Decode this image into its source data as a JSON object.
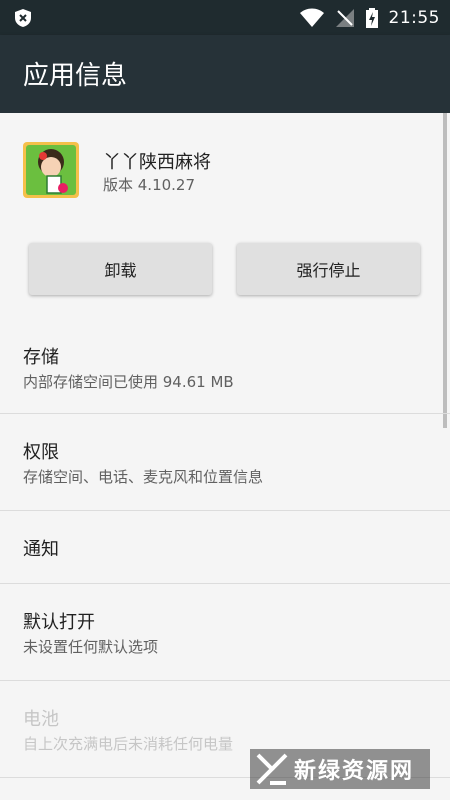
{
  "status_bar": {
    "time": "21:55",
    "icons": [
      "shield-x-icon",
      "wifi-icon",
      "no-signal-icon",
      "battery-charging-icon"
    ]
  },
  "app_bar": {
    "title": "应用信息"
  },
  "app": {
    "name": "丫丫陕西麻将",
    "version": "版本 4.10.27",
    "icon": "mahjong-app-icon"
  },
  "buttons": {
    "uninstall": "卸载",
    "force_stop": "强行停止"
  },
  "sections": {
    "storage": {
      "title": "存储",
      "subtitle": "内部存储空间已使用 94.61 MB"
    },
    "permissions": {
      "title": "权限",
      "subtitle": "存储空间、电话、麦克风和位置信息"
    },
    "notifications": {
      "title": "通知"
    },
    "open_by_default": {
      "title": "默认打开",
      "subtitle": "未设置任何默认选项"
    },
    "battery": {
      "title": "电池",
      "subtitle": "自上次充满电后未消耗任何电量"
    }
  },
  "watermark": {
    "text": "新绿资源网"
  },
  "colors": {
    "status_bar": "#1f2b2f",
    "app_bar": "#263238",
    "background": "#f5f5f5",
    "button": "#e0e0e0",
    "disabled_text": "#c6c6c6"
  }
}
